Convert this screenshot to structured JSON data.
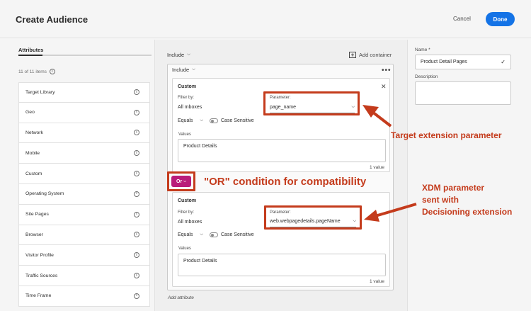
{
  "header": {
    "title": "Create Audience",
    "cancel_label": "Cancel",
    "done_label": "Done",
    "accent": "#1473e6"
  },
  "left_panel": {
    "tab_label": "Attributes",
    "count_text": "11 of 11 items",
    "items": [
      {
        "label": "Target Library"
      },
      {
        "label": "Geo"
      },
      {
        "label": "Network"
      },
      {
        "label": "Mobile"
      },
      {
        "label": "Custom"
      },
      {
        "label": "Operating System"
      },
      {
        "label": "Site Pages"
      },
      {
        "label": "Browser"
      },
      {
        "label": "Visitor Profile"
      },
      {
        "label": "Traffic Sources"
      },
      {
        "label": "Time Frame"
      }
    ]
  },
  "canvas": {
    "include_top": "Include",
    "add_container_label": "Add container",
    "include_inner": "Include",
    "or_label": "Or",
    "add_attribute_label": "Add attribute",
    "cards": [
      {
        "title": "Custom",
        "filter_by_label": "Filter by:",
        "filter_by_value": "All mboxes",
        "parameter_label": "Parameter:",
        "parameter_value": "page_name",
        "operator_value": "Equals",
        "case_sensitive_label": "Case Sensitive",
        "values_label": "Values",
        "values_text": "Product Details",
        "value_count": "1 value"
      },
      {
        "title": "Custom",
        "filter_by_label": "Filter by:",
        "filter_by_value": "All mboxes",
        "parameter_label": "Parameter:",
        "parameter_value": "web.webpagedetails.pageName",
        "operator_value": "Equals",
        "case_sensitive_label": "Case Sensitive",
        "values_label": "Values",
        "values_text": "Product Details",
        "value_count": "1 value"
      }
    ]
  },
  "annotations": {
    "target_param": "Target extension parameter",
    "or_condition": "\"OR\" condition for compatibility",
    "xdm_line1": "XDM parameter",
    "xdm_line2": "sent with",
    "xdm_line3": "Decisioning extension",
    "color": "#c43b1c"
  },
  "right_panel": {
    "name_label": "Name *",
    "name_value": "Product Detail Pages",
    "description_label": "Description"
  }
}
